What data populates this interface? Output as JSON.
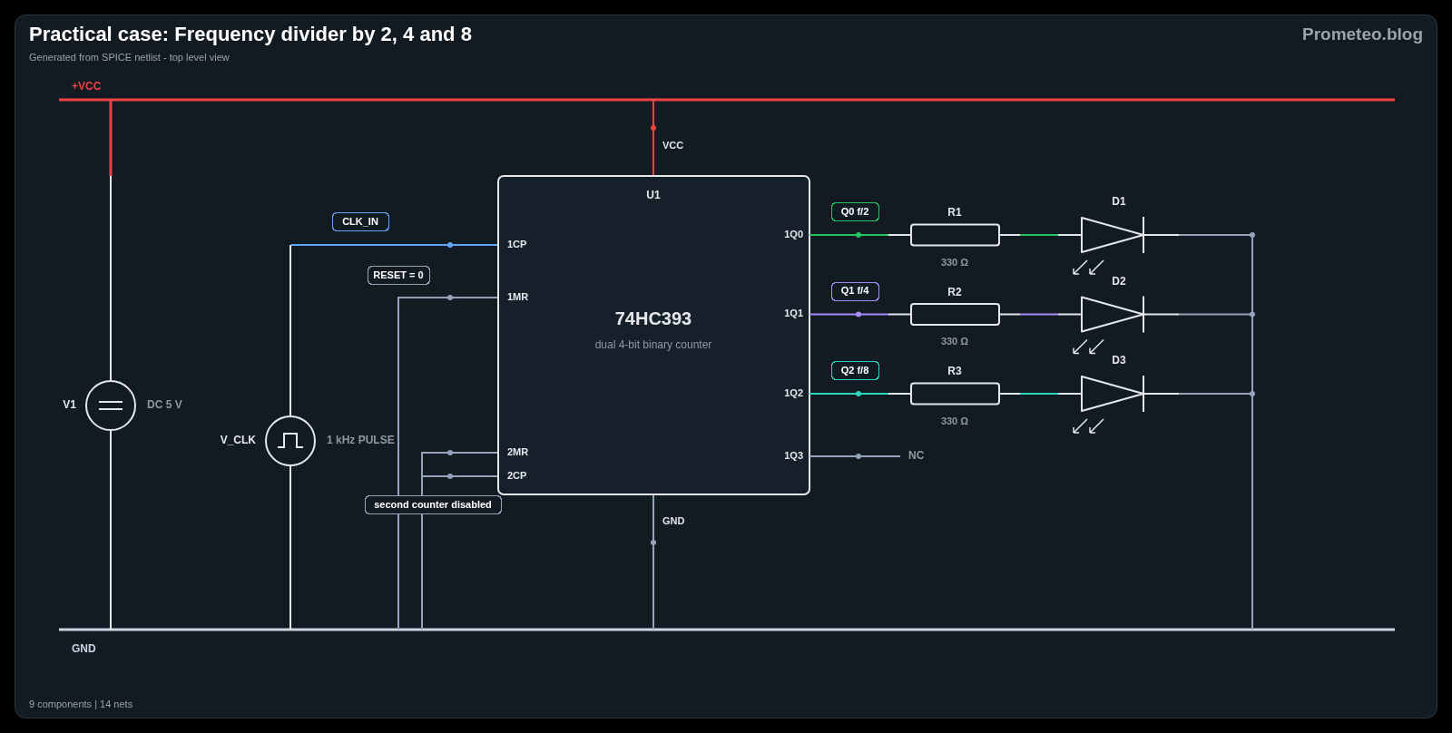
{
  "header": {
    "title": "Practical case: Frequency divider by 2, 4 and 8",
    "subtitle": "Generated from SPICE netlist - top level view",
    "brand": "Prometeo.blog"
  },
  "rails": [
    {
      "kind": "vcc",
      "label": "+VCC"
    },
    {
      "kind": "gnd",
      "label": "GND"
    }
  ],
  "sources": [
    {
      "kind": "dc",
      "name": "V1",
      "value": "DC 5 V"
    },
    {
      "kind": "pulse",
      "name": "V_CLK",
      "value": "1 kHz PULSE"
    }
  ],
  "chip": {
    "ref": "U1",
    "part": "74HC393",
    "description": "dual 4-bit binary counter",
    "power_pin": "VCC",
    "ground_pin": "GND",
    "left_pins": [
      "1CP",
      "1MR",
      "2MR",
      "2CP"
    ]
  },
  "net_tags": [
    {
      "label": "CLK_IN",
      "color": "#60a5fa"
    },
    {
      "label": "RESET = 0",
      "color": "#94a3b8"
    },
    {
      "label": "second counter disabled",
      "color": "#94a3b8"
    }
  ],
  "outputs": [
    {
      "pin": "1Q0",
      "tag": "Q0 f/2",
      "color": "#22c55e",
      "resistor": "R1",
      "resistance": "330 Ω",
      "led": "D1"
    },
    {
      "pin": "1Q1",
      "tag": "Q1 f/4",
      "color": "#a78bfa",
      "resistor": "R2",
      "resistance": "330 Ω",
      "led": "D2"
    },
    {
      "pin": "1Q2",
      "tag": "Q2 f/8",
      "color": "#2dd4bf",
      "resistor": "R3",
      "resistance": "330 Ω",
      "led": "D3"
    }
  ],
  "unused_output": {
    "pin": "1Q3",
    "label": "NC"
  },
  "footer": "9 components | 14 nets"
}
